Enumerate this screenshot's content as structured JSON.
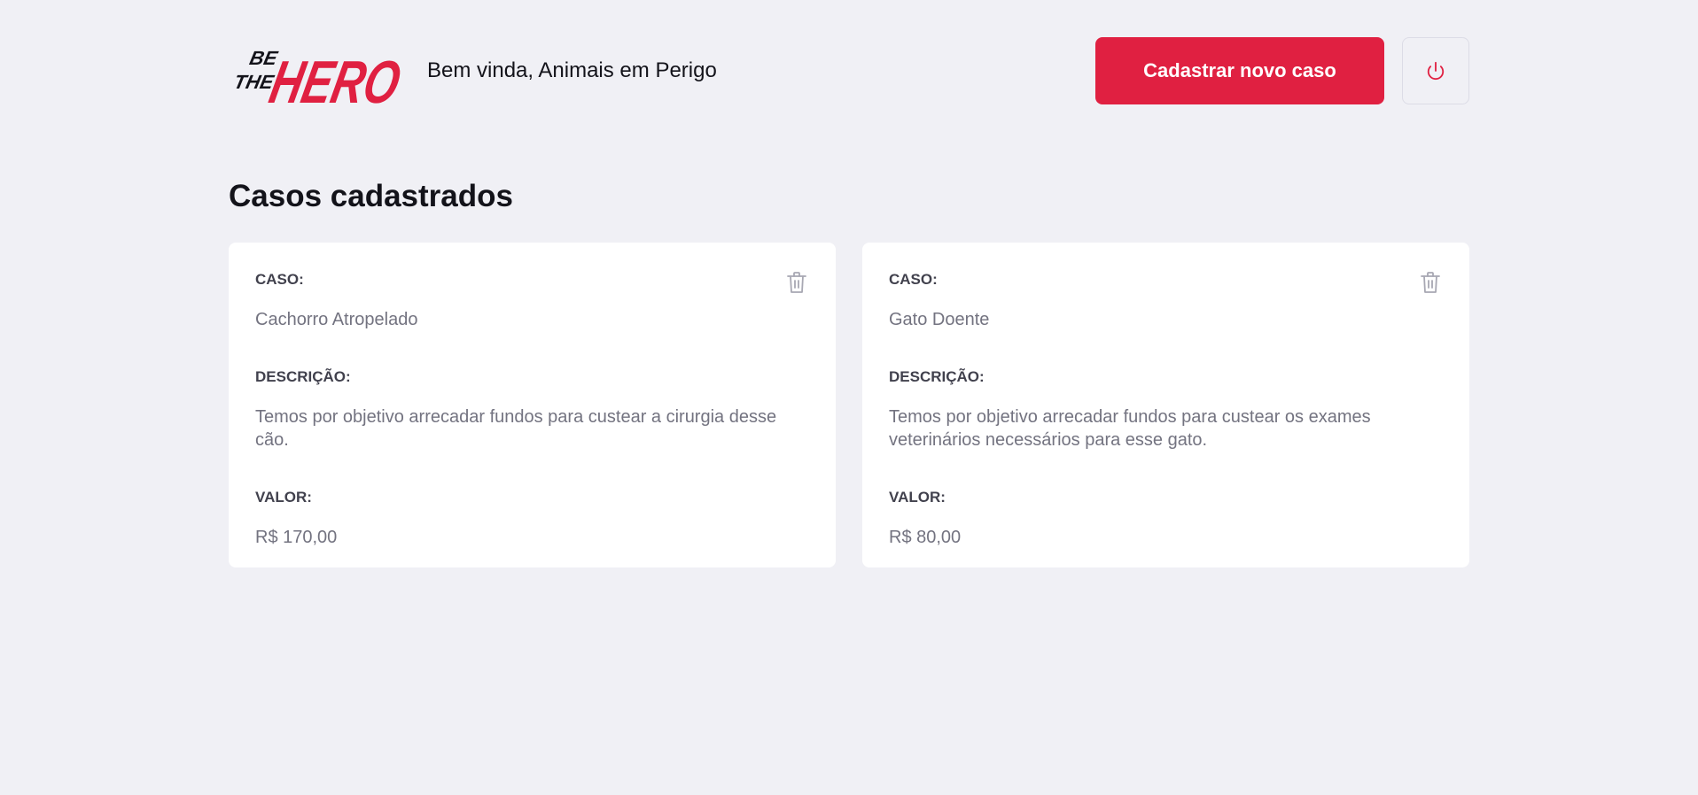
{
  "header": {
    "logo_alt": "Be The Hero",
    "logo_text": {
      "line1": "BE",
      "line2": "THE",
      "hero": "HERO"
    },
    "welcome_text": "Bem vinda, Animais em Perigo",
    "new_case_label": "Cadastrar novo caso",
    "logout_icon": "power-icon"
  },
  "colors": {
    "background": "#f0f0f5",
    "accent": "#e02041",
    "card": "#ffffff",
    "label": "#41414d",
    "value": "#737380"
  },
  "main": {
    "title": "Casos cadastrados",
    "cases": [
      {
        "case_label": "CASO:",
        "case_title": "Cachorro Atropelado",
        "description_label": "DESCRIÇÃO:",
        "description": "Temos por objetivo arrecadar fundos para custear a cirurgia desse cão.",
        "value_label": "VALOR:",
        "value": "R$ 170,00",
        "delete_icon": "trash-icon"
      },
      {
        "case_label": "CASO:",
        "case_title": "Gato Doente",
        "description_label": "DESCRIÇÃO:",
        "description": "Temos por objetivo arrecadar fundos para custear os exames veterinários necessários para esse gato.",
        "value_label": "VALOR:",
        "value": "R$ 80,00",
        "delete_icon": "trash-icon"
      }
    ]
  }
}
